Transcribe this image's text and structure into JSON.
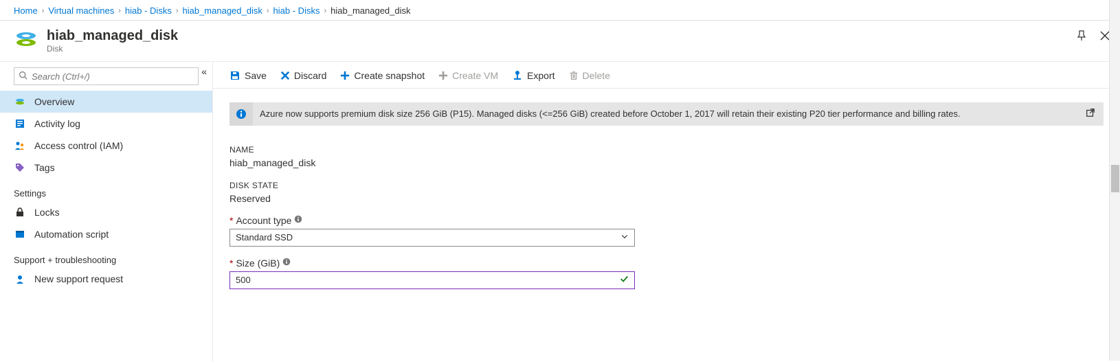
{
  "breadcrumb": {
    "items": [
      {
        "label": "Home",
        "current": false
      },
      {
        "label": "Virtual machines",
        "current": false
      },
      {
        "label": "hiab - Disks",
        "current": false
      },
      {
        "label": "hiab_managed_disk",
        "current": false
      },
      {
        "label": "hiab - Disks",
        "current": false
      },
      {
        "label": "hiab_managed_disk",
        "current": true
      }
    ]
  },
  "header": {
    "title": "hiab_managed_disk",
    "subtitle": "Disk"
  },
  "sidebar": {
    "search_placeholder": "Search (Ctrl+/)",
    "items": [
      {
        "label": "Overview",
        "icon": "disk"
      },
      {
        "label": "Activity log",
        "icon": "log"
      },
      {
        "label": "Access control (IAM)",
        "icon": "iam"
      },
      {
        "label": "Tags",
        "icon": "tag"
      }
    ],
    "headings": {
      "settings": "Settings",
      "support": "Support + troubleshooting"
    },
    "settings_items": [
      {
        "label": "Locks",
        "icon": "lock"
      },
      {
        "label": "Automation script",
        "icon": "script"
      }
    ],
    "support_items": [
      {
        "label": "New support request",
        "icon": "support"
      }
    ]
  },
  "toolbar": {
    "save": "Save",
    "discard": "Discard",
    "create_snapshot": "Create snapshot",
    "create_vm": "Create VM",
    "export": "Export",
    "delete": "Delete"
  },
  "banner": {
    "text": "Azure now supports premium disk size 256 GiB (P15). Managed disks (<=256 GiB) created before October 1, 2017 will retain their existing P20 tier performance and billing rates."
  },
  "form": {
    "name_label": "NAME",
    "name_value": "hiab_managed_disk",
    "state_label": "DISK STATE",
    "state_value": "Reserved",
    "account_type_label": "Account type",
    "account_type_value": "Standard SSD",
    "size_label": "Size (GiB)",
    "size_value": "500"
  }
}
